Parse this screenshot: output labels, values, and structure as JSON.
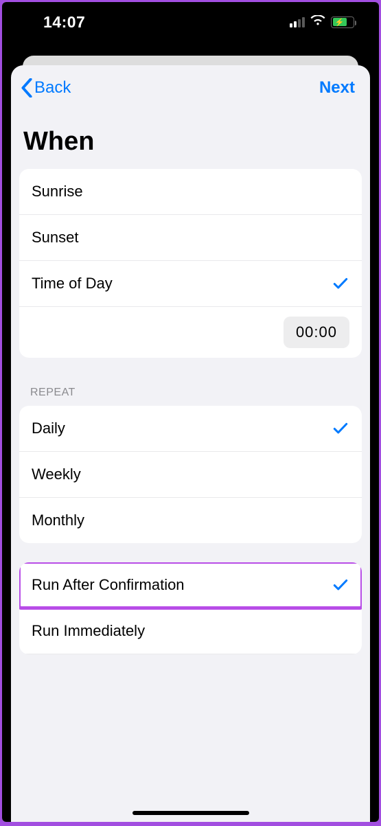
{
  "statusbar": {
    "time": "14:07"
  },
  "nav": {
    "back": "Back",
    "next": "Next"
  },
  "title": "When",
  "when": {
    "items": [
      {
        "label": "Sunrise",
        "checked": false
      },
      {
        "label": "Sunset",
        "checked": false
      },
      {
        "label": "Time of Day",
        "checked": true
      }
    ],
    "time_value": "00:00"
  },
  "repeat": {
    "header": "REPEAT",
    "items": [
      {
        "label": "Daily",
        "checked": true
      },
      {
        "label": "Weekly",
        "checked": false
      },
      {
        "label": "Monthly",
        "checked": false
      }
    ]
  },
  "run": {
    "items": [
      {
        "label": "Run After Confirmation",
        "checked": true
      },
      {
        "label": "Run Immediately",
        "checked": false
      }
    ]
  }
}
